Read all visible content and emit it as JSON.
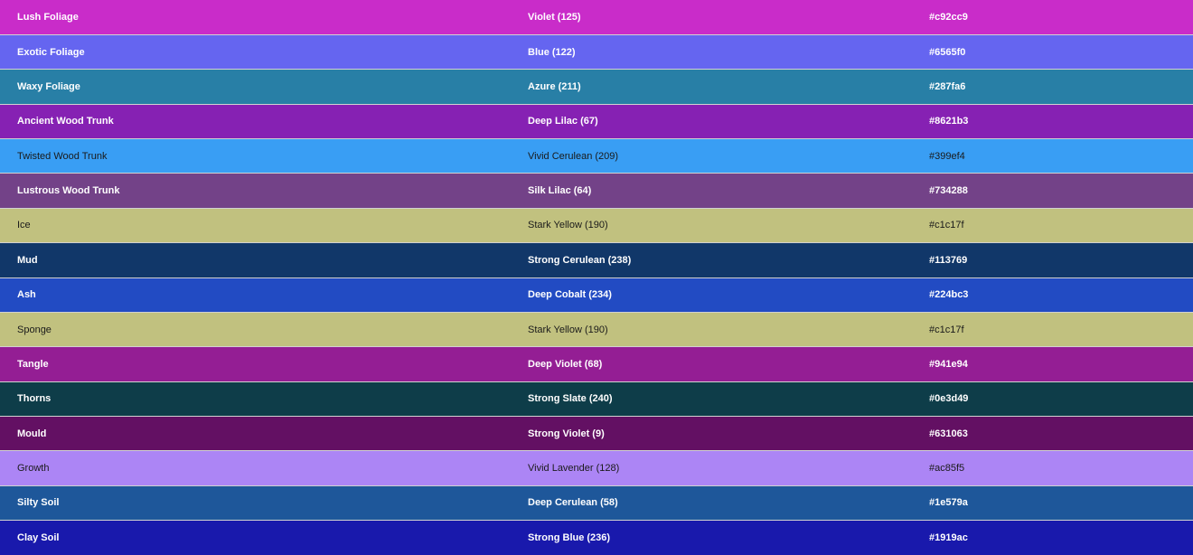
{
  "rows": [
    {
      "name": "Lush Foliage",
      "palette": "Violet (125)",
      "hex": "#c92cc9",
      "text": "light"
    },
    {
      "name": "Exotic Foliage",
      "palette": "Blue (122)",
      "hex": "#6565f0",
      "text": "light"
    },
    {
      "name": "Waxy Foliage",
      "palette": "Azure (211)",
      "hex": "#287fa6",
      "text": "light"
    },
    {
      "name": "Ancient Wood Trunk",
      "palette": "Deep Lilac (67)",
      "hex": "#8621b3",
      "text": "light"
    },
    {
      "name": "Twisted Wood Trunk",
      "palette": "Vivid Cerulean (209)",
      "hex": "#399ef4",
      "text": "dark"
    },
    {
      "name": "Lustrous Wood Trunk",
      "palette": "Silk Lilac (64)",
      "hex": "#734288",
      "text": "light"
    },
    {
      "name": "Ice",
      "palette": "Stark Yellow (190)",
      "hex": "#c1c17f",
      "text": "dark"
    },
    {
      "name": "Mud",
      "palette": "Strong Cerulean (238)",
      "hex": "#113769",
      "text": "light"
    },
    {
      "name": "Ash",
      "palette": "Deep Cobalt (234)",
      "hex": "#224bc3",
      "text": "light"
    },
    {
      "name": "Sponge",
      "palette": "Stark Yellow (190)",
      "hex": "#c1c17f",
      "text": "dark"
    },
    {
      "name": "Tangle",
      "palette": "Deep Violet (68)",
      "hex": "#941e94",
      "text": "light"
    },
    {
      "name": "Thorns",
      "palette": "Strong Slate (240)",
      "hex": "#0e3d49",
      "text": "light"
    },
    {
      "name": "Mould",
      "palette": "Strong Violet (9)",
      "hex": "#631063",
      "text": "light"
    },
    {
      "name": "Growth",
      "palette": "Vivid Lavender (128)",
      "hex": "#ac85f5",
      "text": "dark"
    },
    {
      "name": "Silty Soil",
      "palette": "Deep Cerulean (58)",
      "hex": "#1e579a",
      "text": "light"
    },
    {
      "name": "Clay Soil",
      "palette": "Strong Blue (236)",
      "hex": "#1919ac",
      "text": "light"
    }
  ]
}
